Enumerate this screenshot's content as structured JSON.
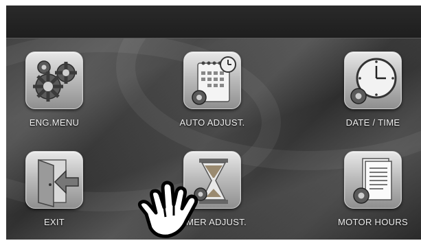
{
  "menu": {
    "items": [
      {
        "label": "ENG.MENU",
        "icon": "gears-icon"
      },
      {
        "label": "AUTO ADJUST.",
        "icon": "calendar-clock-icon"
      },
      {
        "label": "DATE / TIME",
        "icon": "clock-icon"
      },
      {
        "label": "EXIT",
        "icon": "exit-door-icon"
      },
      {
        "label": "TIMER ADJUST.",
        "icon": "hourglass-icon"
      },
      {
        "label": "MOTOR HOURS",
        "icon": "document-gear-icon"
      }
    ]
  },
  "pointer": {
    "icon": "hand-pointer-icon"
  },
  "colors": {
    "background": "#3a3a3a",
    "tile": "#bdbdbd",
    "text": "#f0f0f0"
  }
}
